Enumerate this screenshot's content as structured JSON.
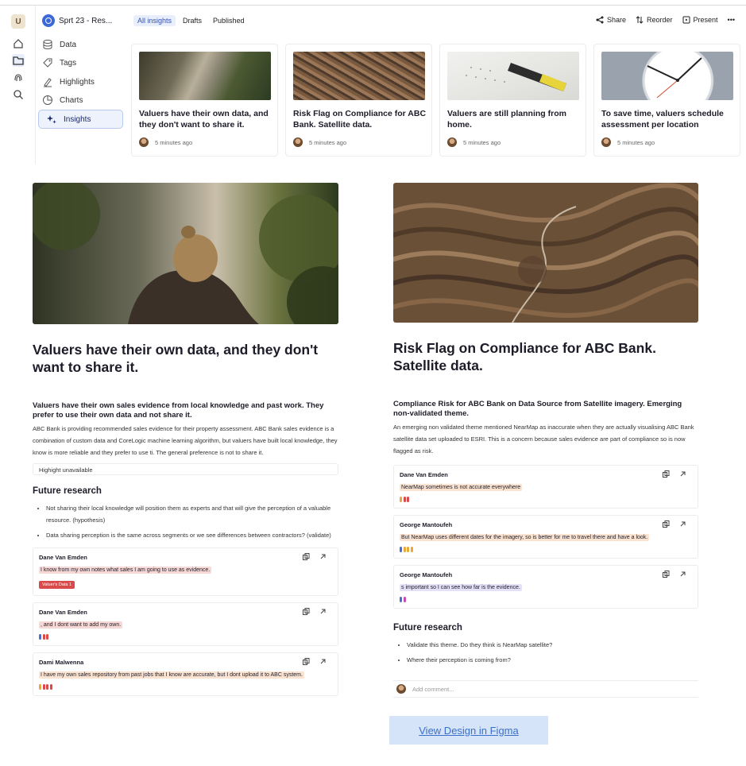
{
  "rail": {
    "avatar": "U"
  },
  "sidebar": {
    "project": "Sprt 23 - Res...",
    "items": [
      {
        "label": "Data",
        "icon": "database-icon"
      },
      {
        "label": "Tags",
        "icon": "tag-icon"
      },
      {
        "label": "Highlights",
        "icon": "highlighter-icon"
      },
      {
        "label": "Charts",
        "icon": "pie-chart-icon"
      },
      {
        "label": "Insights",
        "icon": "sparkles-icon"
      }
    ]
  },
  "tabs": [
    "All insights",
    "Drafts",
    "Published"
  ],
  "tools": {
    "share": "Share",
    "reorder": "Reorder",
    "present": "Present",
    "more": "•••"
  },
  "cards": [
    {
      "title": "Valuers have their own data, and they don't want to share it.",
      "time": "5 minutes ago"
    },
    {
      "title": "Risk Flag on Compliance for ABC Bank. Satellite data.",
      "time": "5 minutes ago"
    },
    {
      "title": "Valuers are still planning from home.",
      "time": "5 minutes ago"
    },
    {
      "title": "To save time, valuers schedule assessment per location",
      "time": "5 minutes ago"
    }
  ],
  "left": {
    "title": "Valuers have their own data, and they don't want to share it.",
    "subtitle": "Valuers have their own sales evidence from local knowledge and past work. They prefer to use their own data and not share it.",
    "body": "ABC Bank is providing recommended sales evidence for their property assessment.  ABC Bank sales evidence is a combination of custom data and CoreLogic machine learning algorithm, but valuers have built local knowledge, they know is more reliable and they prefer to use ti. The general preference is not to share it.",
    "highlight_box": "Highight unavailable",
    "future_title": "Future research",
    "bullets": [
      "Not sharing their local knowledge will position them as experts and that will give the perception of a valuable resource. (hypothesis)",
      "Data sharing perception is the same across segments or we see differences between contractors? (validate)"
    ],
    "quotes": [
      {
        "name": "Dane Van Emden",
        "text": "I know from my own notes what sales I am going to use as evidence.",
        "tag": "Valuer's Data  1"
      },
      {
        "name": "Dane Van Emden",
        "text": ", and I dont want to add my own."
      },
      {
        "name": "Dami Malwenna",
        "text": "I have my own sales repository from past jobs that I know are accurate, but I dont upload it to ABC system."
      }
    ]
  },
  "right": {
    "title": "Risk Flag on Compliance for ABC Bank. Satellite data.",
    "subtitle": "Compliance Risk for ABC Bank on Data Source from Satellite imagery. Emerging non-validated theme.",
    "body": "An emerging non validated theme mentioned NearMap as inaccurate when they are actually visualising ABC Bank satellite data set uploaded to ESRI. This is a concern because sales evidence are part of compliance so is now flagged as risk.",
    "quotes": [
      {
        "name": "Dane Van Emden",
        "text": "NearMap sometimes is not accurate everywhere"
      },
      {
        "name": "George Mantoufeh",
        "text": "But NearMap uses different dates for the imagery, so is better for me to travel there and have a look."
      },
      {
        "name": "George Mantoufeh",
        "text": "s important so I can see how far is the evidence."
      }
    ],
    "future_title": "Future research",
    "bullets": [
      "Validate this theme. Do they think is NearMap satellite?",
      "Where their perception is coming from?"
    ],
    "comment_placeholder": "Add comment..."
  },
  "figma_link": "View Design in Figma",
  "colors": {
    "accent": "#3350b0",
    "highlight_red": "#f6d9d6",
    "highlight_orange": "#fbe3d2",
    "highlight_purple": "#e4e0f6",
    "tag_red": "#d94a4a"
  }
}
